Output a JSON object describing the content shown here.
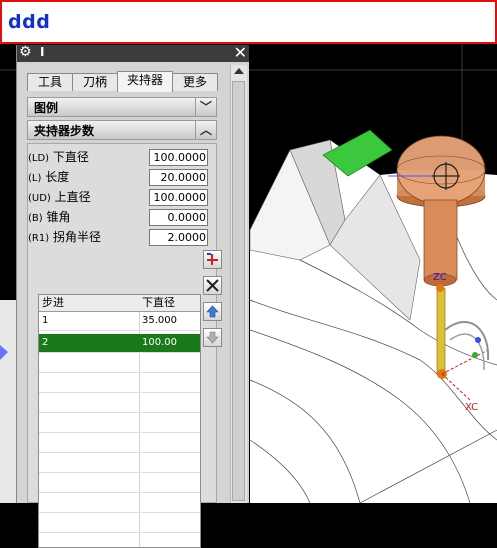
{
  "window": {
    "title": "ddd"
  },
  "panel": {
    "tabs": [
      {
        "label": "工具"
      },
      {
        "label": "刀柄"
      },
      {
        "label": "夹持器"
      },
      {
        "label": "更多"
      }
    ],
    "legend_section": {
      "label": "图例"
    },
    "holder_steps_section": {
      "label": "夹持器步数"
    },
    "params": [
      {
        "code": "(LD)",
        "label": "下直径",
        "value": "100.0000"
      },
      {
        "code": "(L)",
        "label": "长度",
        "value": "20.0000"
      },
      {
        "code": "(UD)",
        "label": "上直径",
        "value": "100.0000"
      },
      {
        "code": "(B)",
        "label": "锥角",
        "value": "0.0000"
      },
      {
        "code": "(R1)",
        "label": "拐角半径",
        "value": "2.0000"
      }
    ],
    "steps_table": {
      "headers": [
        "步进",
        "下直径"
      ],
      "rows": [
        {
          "step": "1",
          "lower_diameter": "35.000"
        },
        {
          "step": "2",
          "lower_diameter": "100.00"
        }
      ],
      "selected_row": 1
    },
    "side_buttons": [
      {
        "icon": "add-step-icon"
      },
      {
        "icon": "delete-step-icon"
      },
      {
        "icon": "move-up-icon"
      },
      {
        "icon": "move-down-icon"
      }
    ]
  },
  "viewport": {
    "axis_labels": {
      "zc": "ZC",
      "xc": "XC"
    }
  },
  "colors": {
    "title_text": "#1030d0",
    "title_border": "#e01010",
    "selected_row": "#1a7a1a",
    "holder_orange": "#d98b5a"
  }
}
